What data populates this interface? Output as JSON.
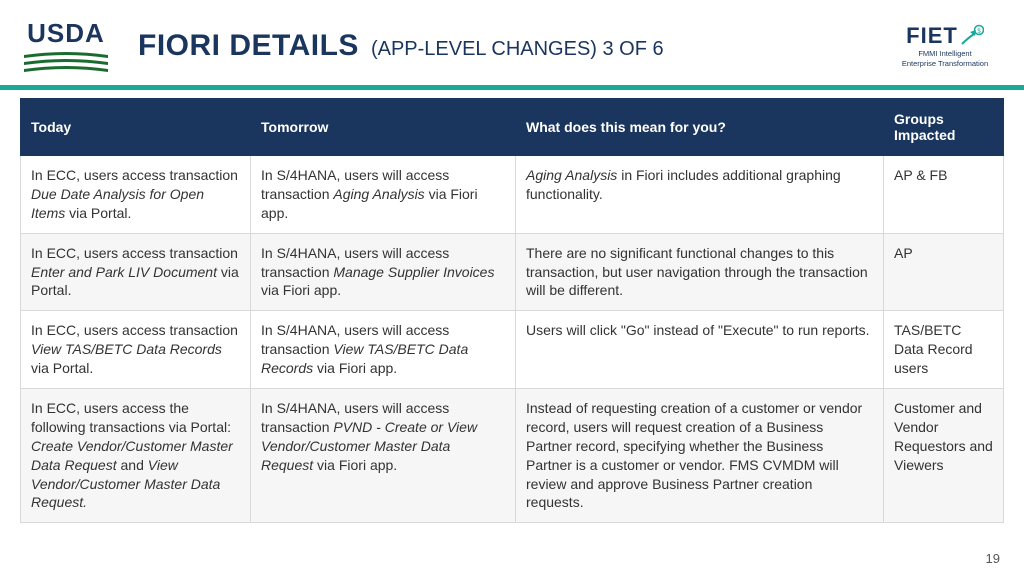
{
  "header": {
    "usda_text": "USDA",
    "title_main": "FIORI DETAILS",
    "title_sub": "(APP-LEVEL CHANGES) 3 OF 6",
    "fiet_text": "FIET",
    "fiet_sub1": "FMMI Intelligent",
    "fiet_sub2": "Enterprise Transformation"
  },
  "table": {
    "headers": {
      "today": "Today",
      "tomorrow": "Tomorrow",
      "meaning": "What does this mean for you?",
      "groups": "Groups Impacted"
    },
    "rows": [
      {
        "today_pre": "In ECC, users access transaction ",
        "today_em": "Due Date Analysis for Open Items",
        "today_post": " via Portal.",
        "tomorrow_pre": "In S/4HANA, users will access transaction ",
        "tomorrow_em": "Aging Analysis",
        "tomorrow_post": " via Fiori app.",
        "meaning_em": "Aging Analysis",
        "meaning_post": " in Fiori includes additional graphing functionality.",
        "groups": "AP & FB"
      },
      {
        "today_pre": "In ECC, users access transaction ",
        "today_em": "Enter and Park LIV Document",
        "today_post": " via Portal.",
        "tomorrow_pre": "In S/4HANA, users will access transaction ",
        "tomorrow_em": "Manage Supplier Invoices",
        "tomorrow_post": " via Fiori app.",
        "meaning_pre": "There are no significant functional changes to this transaction, but user navigation through the transaction will be different.",
        "groups": "AP"
      },
      {
        "today_pre": "In ECC, users access transaction ",
        "today_em": "View TAS/BETC Data Records",
        "today_post": " via Portal.",
        "tomorrow_pre": "In S/4HANA, users will access transaction ",
        "tomorrow_em": "View TAS/BETC Data Records",
        "tomorrow_post": " via Fiori app.",
        "meaning_pre": "Users will click \"Go\" instead of \"Execute\" to run reports.",
        "groups": "TAS/BETC Data Record users"
      },
      {
        "today_pre": "In ECC, users access the following transactions via Portal: ",
        "today_em": "Create Vendor/Customer Master Data Request",
        "today_mid": " and ",
        "today_em2": "View Vendor/Customer Master Data Request.",
        "tomorrow_pre": "In S/4HANA, users will access transaction ",
        "tomorrow_em": "PVND - Create or View Vendor/Customer Master Data Request",
        "tomorrow_post": " via Fiori app.",
        "meaning_pre": "Instead of requesting creation of a customer or vendor record, users will request creation of a Business Partner record, specifying whether the Business Partner is a customer or vendor. FMS CVMDM will review and approve Business Partner creation requests.",
        "groups": "Customer and Vendor Requestors and Viewers"
      }
    ]
  },
  "page_number": "19"
}
